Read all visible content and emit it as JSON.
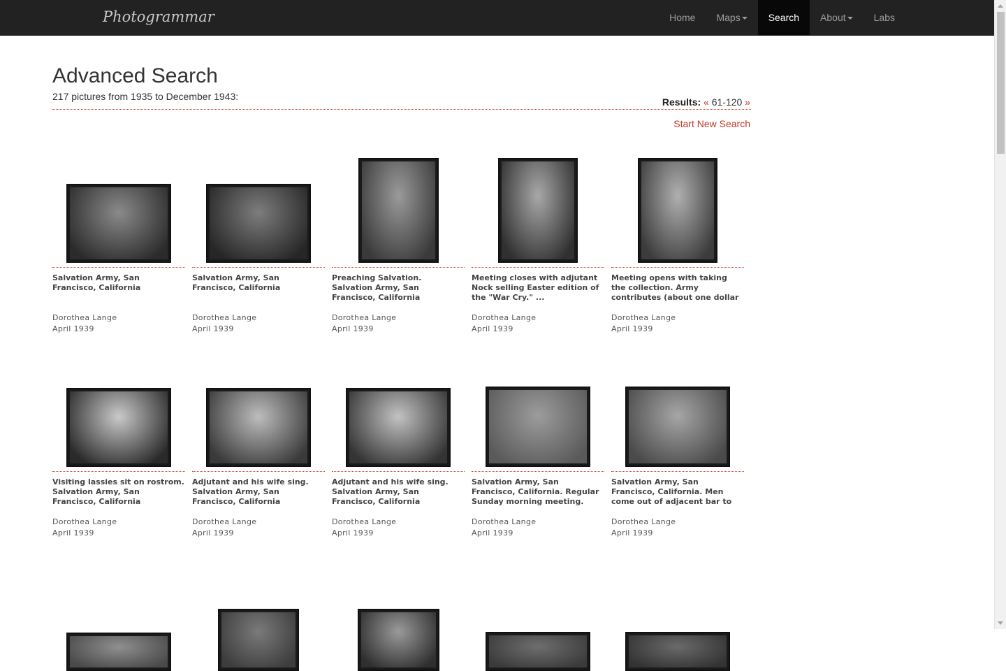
{
  "nav": {
    "brand": "Photogrammar",
    "items": [
      {
        "label": "Home"
      },
      {
        "label": "Maps"
      },
      {
        "label": "Search"
      },
      {
        "label": "About"
      },
      {
        "label": "Labs"
      }
    ]
  },
  "header": {
    "title": "Advanced Search",
    "summary": "217 pictures from 1935 to December 1943:",
    "results_label": "Results:",
    "prev": "«",
    "range": "61-120",
    "next": "»",
    "new_search": "Start New Search"
  },
  "photos": [
    {
      "caption": "Salvation Army, San Francisco, California",
      "author": "Dorothea Lange",
      "date": "April 1939"
    },
    {
      "caption": "Salvation Army, San Francisco, California",
      "author": "Dorothea Lange",
      "date": "April 1939"
    },
    {
      "caption": "Preaching Salvation. Salvation Army, San Francisco, California",
      "author": "Dorothea Lange",
      "date": "April 1939"
    },
    {
      "caption": "Meeting closes with adjutant Nock selling Easter edition of the \"War Cry.\" ...",
      "author": "Dorothea Lange",
      "date": "April 1939"
    },
    {
      "caption": "Meeting opens with taking the collection. Army contributes (about one dollar and fift...",
      "author": "Dorothea Lange",
      "date": "April 1939"
    },
    {
      "caption": "Visiting lassies sit on rostrom. Salvation Army, San Francisco, California",
      "author": "Dorothea Lange",
      "date": "April 1939"
    },
    {
      "caption": "Adjutant and his wife sing. Salvation Army, San Francisco, California",
      "author": "Dorothea Lange",
      "date": "April 1939"
    },
    {
      "caption": "Adjutant and his wife sing. Salvation Army, San Francisco, California",
      "author": "Dorothea Lange",
      "date": "April 1939"
    },
    {
      "caption": "Salvation Army, San Francisco, California. Regular Sunday morning meeting. (Meeting h...",
      "author": "Dorothea Lange",
      "date": "April 1939"
    },
    {
      "caption": "Salvation Army, San Francisco, California. Men come out of adjacent bar to watch, and...",
      "author": "Dorothea Lange",
      "date": "April 1939"
    },
    {
      "caption": "",
      "author": "",
      "date": ""
    },
    {
      "caption": "",
      "author": "",
      "date": ""
    },
    {
      "caption": "",
      "author": "",
      "date": ""
    },
    {
      "caption": "",
      "author": "",
      "date": ""
    },
    {
      "caption": "",
      "author": "",
      "date": ""
    }
  ]
}
